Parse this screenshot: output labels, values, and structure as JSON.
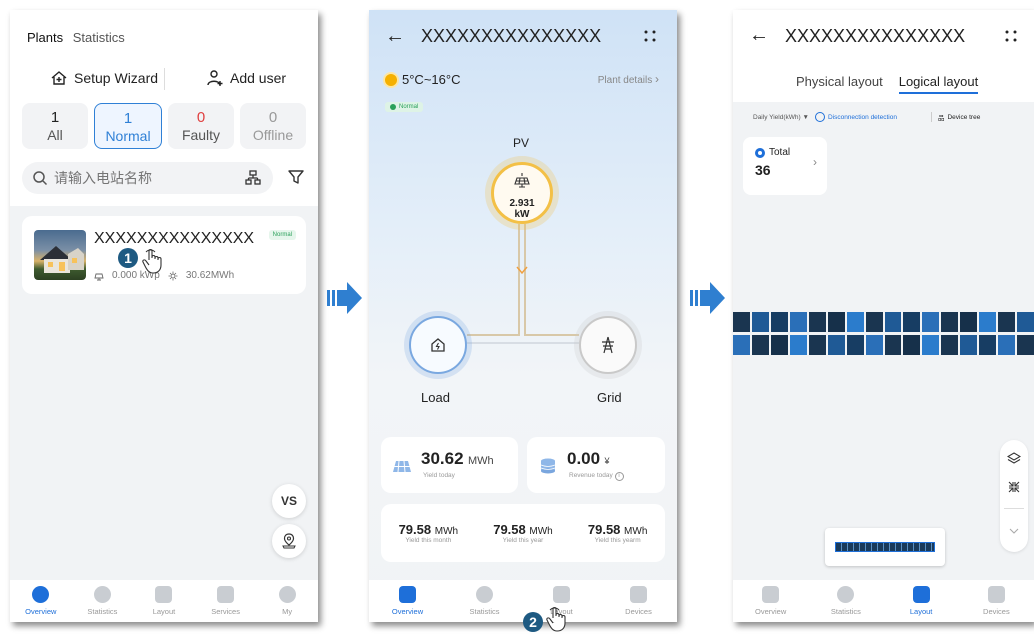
{
  "phone1": {
    "tabs": [
      "Plants",
      "Statistics"
    ],
    "setup_wizard": "Setup Wizard",
    "add_user": "Add user",
    "stats": [
      {
        "count": "1",
        "label": "All"
      },
      {
        "count": "1",
        "label": "Normal"
      },
      {
        "count": "0",
        "label": "Faulty"
      },
      {
        "count": "0",
        "label": "Offline"
      }
    ],
    "search_placeholder": "请输入电站名称",
    "plant": {
      "name": "XXXXXXXXXXXXXXX",
      "status": "Normal",
      "capacity": "0.000 kWp",
      "yield": "30.62MWh"
    },
    "fab_vs": "VS",
    "nav": [
      "Overview",
      "Statistics",
      "Layout",
      "Services",
      "My"
    ]
  },
  "phone2": {
    "title": "XXXXXXXXXXXXXXX",
    "weather": "5°C~16°C",
    "plant_details": "Plant details",
    "status": "Normal",
    "pv_label": "PV",
    "pv_value": "2.931",
    "pv_unit": "kW",
    "load_label": "Load",
    "grid_label": "Grid",
    "yield_today": {
      "value": "30.62",
      "unit": "MWh",
      "label": "Yield today"
    },
    "revenue_today": {
      "value": "0.00",
      "unit": "¥",
      "label": "Revenue today"
    },
    "yields": [
      {
        "value": "79.58",
        "unit": "MWh",
        "label": "Yield this month"
      },
      {
        "value": "79.58",
        "unit": "MWh",
        "label": "Yield this year"
      },
      {
        "value": "79.58",
        "unit": "MWh",
        "label": "Yield this yearm"
      }
    ],
    "nav": [
      "Overview",
      "Statistics",
      "Layout",
      "Devices"
    ]
  },
  "phone3": {
    "title": "XXXXXXXXXXXXXXX",
    "tabs": [
      "Physical layout",
      "Logical layout"
    ],
    "daily_yield": "Daily Yield(kWh)",
    "disconnection": "Disconnection detection",
    "device_tree": "Device tree",
    "total_label": "Total",
    "total_count": "36",
    "nav": [
      "Overview",
      "Statistics",
      "Layout",
      "Devices"
    ]
  },
  "steps": [
    "1",
    "2"
  ],
  "colors": {
    "accent": "#1e6fd9",
    "normal_green": "#2aa05a",
    "fault_red": "#e04040",
    "step_badge": "#1e5a82",
    "pv_ring": "#f3c046",
    "arrow": "#2f7fd0"
  }
}
